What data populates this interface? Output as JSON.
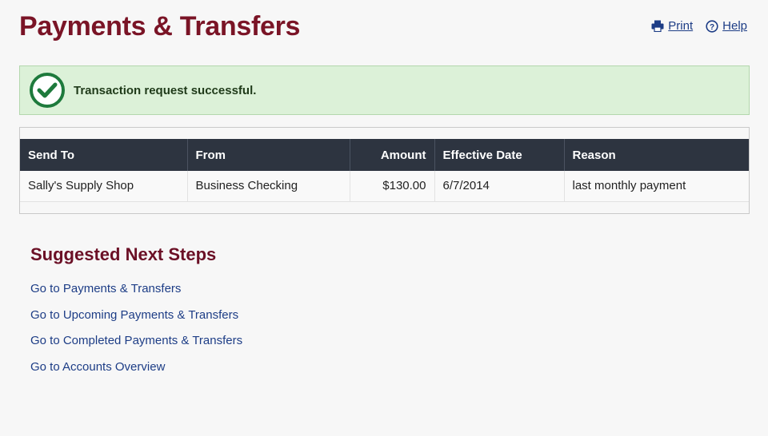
{
  "page": {
    "title": "Payments & Transfers"
  },
  "top_links": {
    "print_label": "Print",
    "help_label": "Help"
  },
  "alert": {
    "message": "Transaction request successful.",
    "icon": "check-circle-icon",
    "color": "#1e7a3c"
  },
  "table": {
    "headers": [
      "Send To",
      "From",
      "Amount",
      "Effective Date",
      "Reason"
    ],
    "rows": [
      [
        "Sally's Supply Shop",
        "Business Checking",
        "$130.00",
        "6/7/2014",
        "last monthly payment"
      ]
    ]
  },
  "next_steps": {
    "title": "Suggested Next Steps",
    "links": [
      "Go to Payments & Transfers",
      "Go to Upcoming Payments & Transfers",
      "Go to Completed Payments & Transfers",
      "Go to Accounts Overview"
    ]
  },
  "colors": {
    "brand": "#7a1426",
    "link": "#1d3d86",
    "table_header": "#2d3440",
    "success_bg": "#dcf1d8"
  }
}
